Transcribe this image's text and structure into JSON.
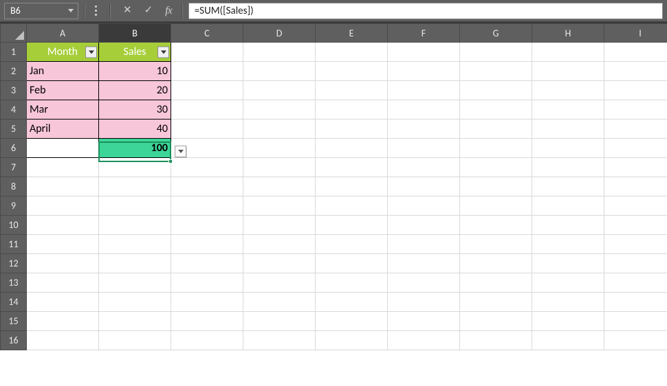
{
  "formula_bar": {
    "cell_ref": "B6",
    "formula": "=SUM([Sales])"
  },
  "columns": [
    "A",
    "B",
    "C",
    "D",
    "E",
    "F",
    "G",
    "H",
    "I"
  ],
  "row_numbers": [
    1,
    2,
    3,
    4,
    5,
    6,
    7,
    8,
    9,
    10,
    11,
    12,
    13,
    14,
    15,
    16
  ],
  "table": {
    "headers": {
      "col1": "Month",
      "col2": "Sales"
    },
    "rows": [
      {
        "month": "Jan",
        "sales": "10"
      },
      {
        "month": "Feb",
        "sales": "20"
      },
      {
        "month": "Mar",
        "sales": "30"
      },
      {
        "month": "April",
        "sales": "40"
      }
    ],
    "total": "100"
  },
  "active_cell": "B6"
}
